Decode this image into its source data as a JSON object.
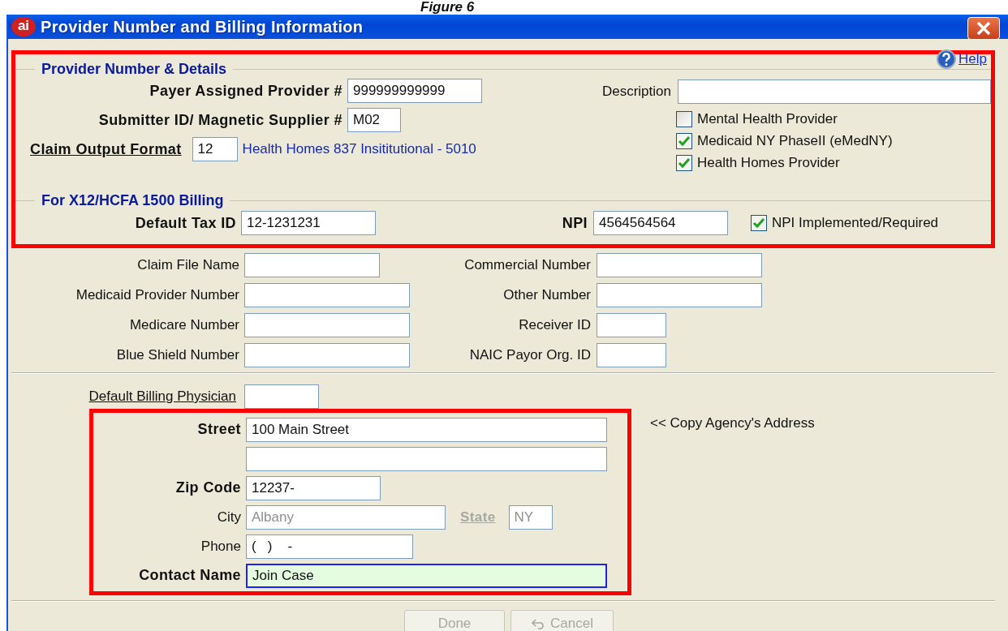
{
  "caption": "Figure 6",
  "window": {
    "logo": "ai",
    "title": "Provider Number and Billing Information"
  },
  "help_link": "Help",
  "provider_section": {
    "highlighted": true,
    "legend": "Provider Number & Details",
    "payer_assigned_provider": {
      "label": "Payer Assigned Provider #",
      "value": "999999999999",
      "bold": true
    },
    "submitter_id": {
      "label": "Submitter ID/ Magnetic Supplier #",
      "value": "M02",
      "bold": true
    },
    "claim_output_format": {
      "label": "Claim Output Format",
      "value": "12",
      "description": "Health Homes 837 Insititutional - 5010",
      "bold": true
    },
    "description": {
      "label": "Description"
    },
    "checkboxes": [
      {
        "label": "Mental Health Provider",
        "checked": false
      },
      {
        "label": "Medicaid NY PhaseII (eMedNY)",
        "checked": true
      },
      {
        "label": "Health Homes Provider",
        "checked": true
      }
    ],
    "billing_legend": "For X12/HCFA 1500 Billing",
    "default_tax_id": {
      "label": "Default Tax ID",
      "value": "12-1231231",
      "bold": true
    },
    "npi": {
      "label": "NPI",
      "value": "4564564564",
      "bold": true
    },
    "npi_implemented": {
      "label": "NPI Implemented/Required",
      "checked": true
    }
  },
  "number_rows": [
    {
      "left_label": "Claim File Name",
      "right_label": "Commercial Number"
    },
    {
      "left_label": "Medicaid Provider Number",
      "right_label": "Other Number"
    },
    {
      "left_label": "Medicare Number",
      "right_label": "Receiver ID"
    },
    {
      "left_label": "Blue Shield Number",
      "right_label": "NAIC Payor Org. ID"
    }
  ],
  "default_billing_physician": {
    "label": "Default Billing Physician"
  },
  "address_section": {
    "highlighted": true,
    "street": {
      "label": "Street",
      "value": "100 Main Street"
    },
    "zip_code": {
      "label": "Zip Code",
      "value": "12237-"
    },
    "city": {
      "label": "City",
      "value": "Albany",
      "disabled": true
    },
    "state": {
      "label": "State",
      "value": "NY",
      "disabled": true
    },
    "phone": {
      "label": "Phone",
      "value": "(   )    -"
    },
    "contact_name": {
      "label": "Contact Name",
      "value": "Join Case",
      "focused": true
    }
  },
  "copy_address_link": "<< Copy Agency's Address",
  "buttons": [
    {
      "kind": "done",
      "label": "Done",
      "disabled": true
    },
    {
      "kind": "cancel",
      "label": "Cancel",
      "disabled": true
    }
  ]
}
